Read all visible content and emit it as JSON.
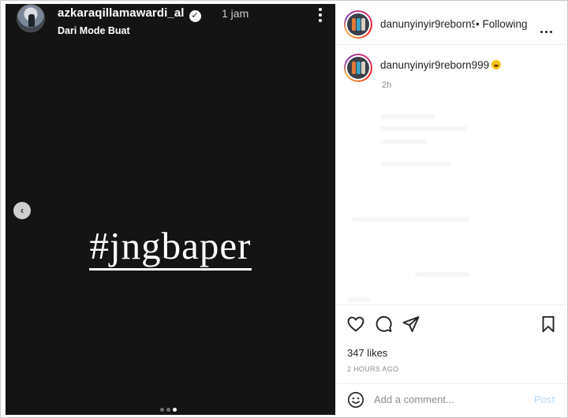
{
  "story": {
    "username": "azkaraqillamawardi_al",
    "time": "1 jam",
    "subtitle": "Dari Mode Buat",
    "hashtag_text": "#jngbaper",
    "carousel_dots": 3,
    "carousel_active_index": 2
  },
  "post_header": {
    "username": "danunyinyir9reborn999",
    "separator": "•",
    "follow_status": "Following",
    "more_icon": "more-horizontal-icon"
  },
  "caption": {
    "username": "danunyinyir9reborn999",
    "emoji": "laughing-emoji",
    "time": "2h"
  },
  "actions": {
    "like_icon": "heart-icon",
    "comment_icon": "comment-icon",
    "share_icon": "send-icon",
    "save_icon": "bookmark-icon"
  },
  "likes_text": "347 likes",
  "posted_time": "2 HOURS AGO",
  "comment": {
    "placeholder": "Add a comment...",
    "post_label": "Post"
  },
  "colors": {
    "media_background": "#141414",
    "post_button_disabled": "#b9dcf7",
    "muted_text": "#8e8e8e"
  }
}
